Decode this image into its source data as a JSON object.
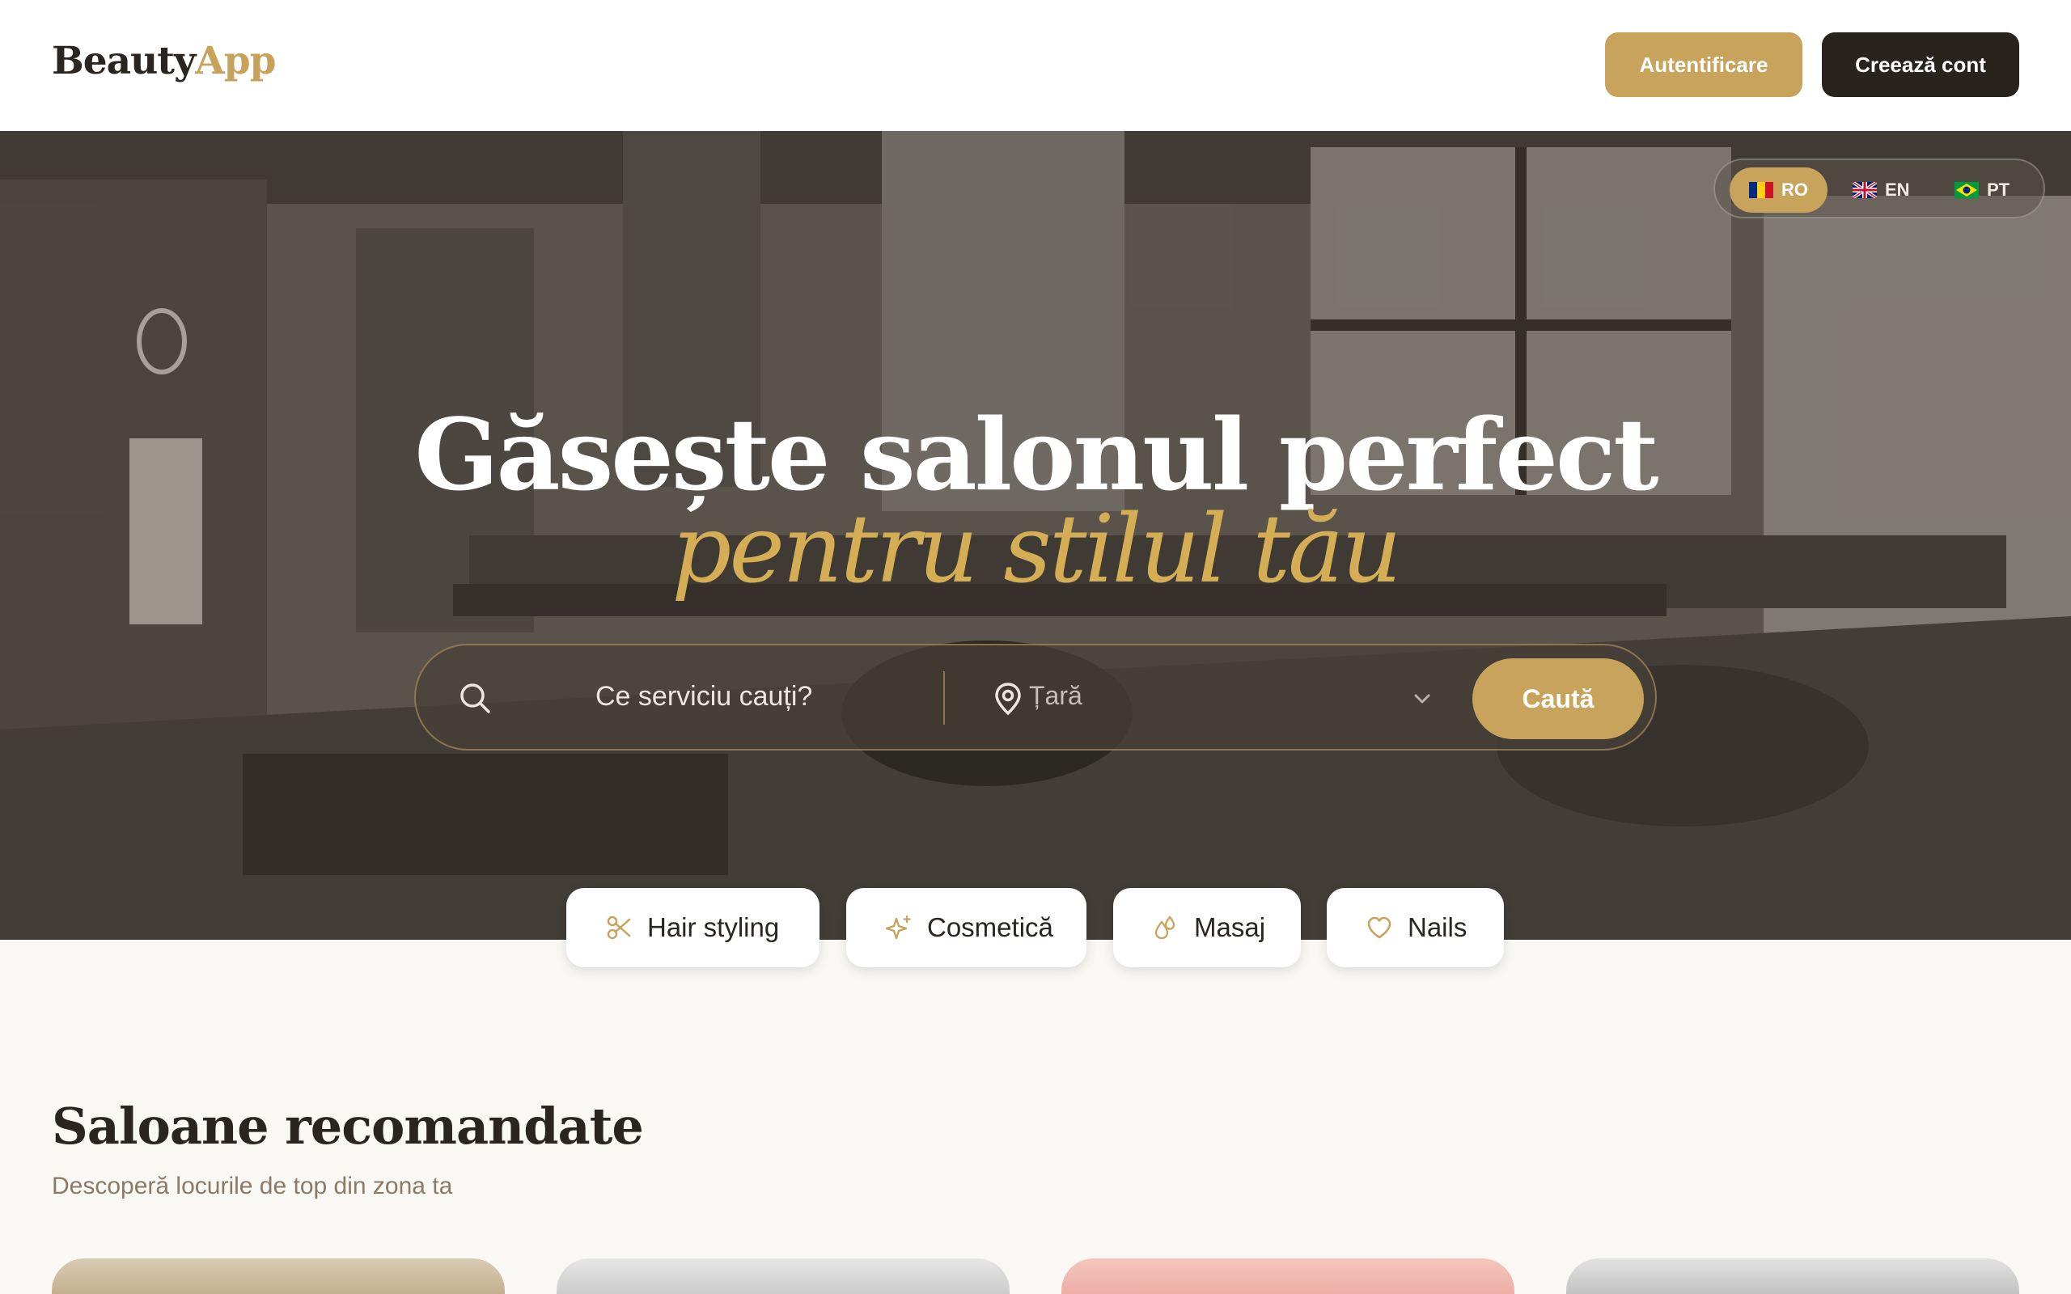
{
  "header": {
    "logo_part1": "Beauty",
    "logo_part2": "App",
    "login_label": "Autentificare",
    "signup_label": "Creează cont"
  },
  "languages": [
    {
      "code": "RO",
      "active": true
    },
    {
      "code": "EN",
      "active": false
    },
    {
      "code": "PT",
      "active": false
    }
  ],
  "hero": {
    "title_line1": "Găsește salonul perfect",
    "title_line2": "pentru stilul tău"
  },
  "search": {
    "service_placeholder": "Ce serviciu cauți?",
    "location_placeholder": "Țară",
    "button_label": "Caută"
  },
  "categories": [
    {
      "label": "Hair styling",
      "icon": "scissors-icon"
    },
    {
      "label": "Cosmetică",
      "icon": "sparkles-icon"
    },
    {
      "label": "Masaj",
      "icon": "droplets-icon"
    },
    {
      "label": "Nails",
      "icon": "heart-icon"
    }
  ],
  "recommended": {
    "title": "Saloane recomandate",
    "subtitle": "Descoperă locurile de top din zona ta"
  },
  "colors": {
    "accent": "#c7a35c",
    "dark": "#29231e",
    "background": "#faf8f5"
  }
}
